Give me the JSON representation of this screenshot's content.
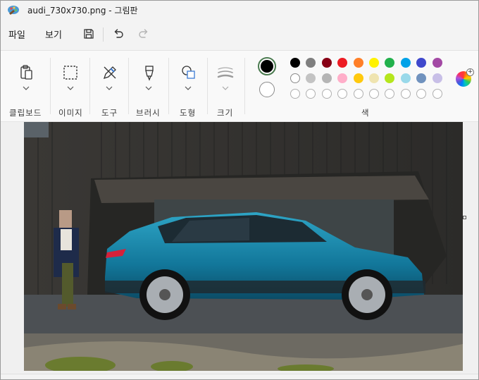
{
  "window": {
    "title": "audi_730x730.png - 그림판"
  },
  "menu": {
    "file": "파일",
    "view": "보기"
  },
  "toolbar": {
    "save_icon": "floppy-disk-icon",
    "undo_icon": "undo-icon",
    "redo_icon": "redo-icon"
  },
  "ribbon": {
    "clipboard": "클립보드",
    "image": "이미지",
    "tools": "도구",
    "brush": "브러시",
    "shapes": "도형",
    "size": "크기",
    "colors": "색"
  },
  "colors": {
    "primary": "#000000",
    "secondary": "#ffffff",
    "row1": [
      "#000000",
      "#7f7f7f",
      "#880015",
      "#ed1c24",
      "#ff7f27",
      "#fff200",
      "#22b14c",
      "#00a2e8",
      "#3f48cc",
      "#a349a4"
    ],
    "row2": [
      "#ffffff",
      "#c3c3c3",
      "#b5b5b5",
      "#ffaec9",
      "#ffc90e",
      "#efe4b0",
      "#b5e61d",
      "#99d9ea",
      "#7092be",
      "#c8bfe7"
    ]
  },
  "canvas": {
    "sky": "#2a2a2a",
    "car_color": "#1581a0"
  }
}
